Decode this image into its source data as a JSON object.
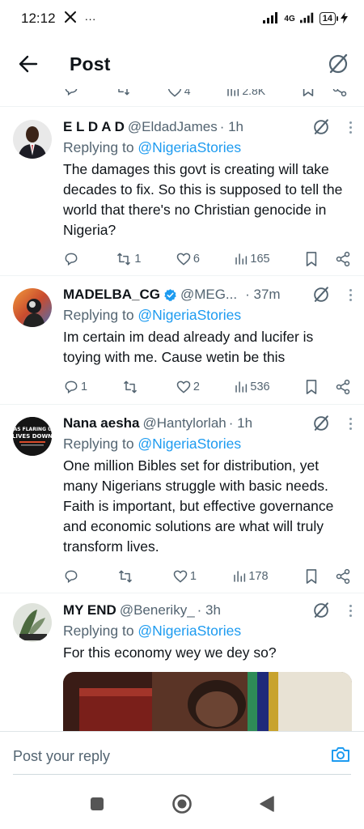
{
  "status_bar": {
    "time": "12:12",
    "dots": "···",
    "network": "4G",
    "battery": "14"
  },
  "header": {
    "title": "Post"
  },
  "partial_row": {
    "likes": "4",
    "views": "2.8K"
  },
  "reply_prefix": "Replying to ",
  "tweets": [
    {
      "name": "E L D A D",
      "handle": "@EldadJames",
      "time": "· 1h",
      "reply_to": "@NigeriaStories",
      "text": "The damages this govt is creating will take decades to fix. So this is supposed to tell the world that there's no Christian genocide in Nigeria?",
      "replies": "",
      "retweets": "1",
      "likes": "6",
      "views": "165"
    },
    {
      "name": "MADELBA_CG",
      "handle": "@MEG...",
      "time": "· 37m",
      "reply_to": "@NigeriaStories",
      "text": "Im certain  im dead already and lucifer is toying with me. Cause wetin be this",
      "replies": "1",
      "retweets": "",
      "likes": "2",
      "views": "536"
    },
    {
      "name": "Nana aesha",
      "handle": "@Hantylorlah",
      "time": "· 1h",
      "reply_to": "@NigeriaStories",
      "avatar_text": "GAS FLARING UP LIVES DOWN",
      "text": "One million Bibles set for distribution, yet many Nigerians struggle with basic needs. Faith is important, but effective governance and economic solutions are what will truly transform lives.",
      "replies": "",
      "retweets": "",
      "likes": "1",
      "views": "178"
    },
    {
      "name": "MY END",
      "handle": "@Beneriky_",
      "time": "· 3h",
      "reply_to": "@NigeriaStories",
      "text": "For this economy wey we dey so?"
    }
  ],
  "reply_bar": {
    "placeholder": "Post your reply"
  },
  "colors": {
    "accent": "#1d9bf0",
    "muted": "#536471",
    "text": "#0f1419"
  }
}
